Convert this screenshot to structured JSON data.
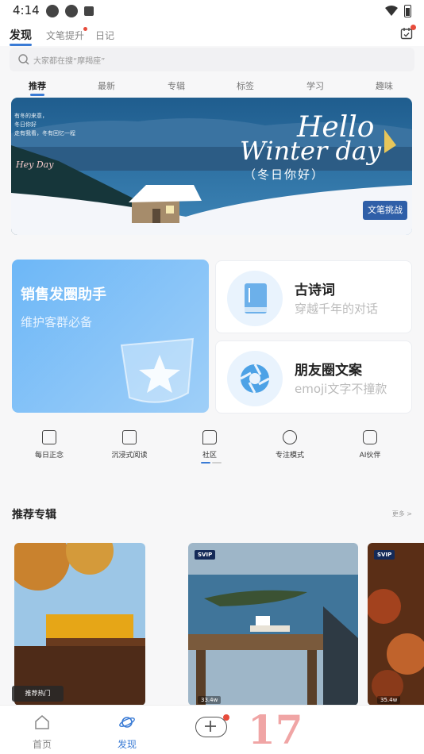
{
  "status": {
    "time": "4:14"
  },
  "header": {
    "tabs": [
      {
        "label": "发现",
        "active": true
      },
      {
        "label": "文笔提升",
        "active": false,
        "badge": true
      },
      {
        "label": "日记",
        "active": false
      }
    ]
  },
  "search": {
    "placeholder": "大家都在搜“摩羯座”"
  },
  "categories": [
    "推荐",
    "最新",
    "专辑",
    "标签",
    "学习",
    "趣味"
  ],
  "banner": {
    "title_line1": "Hello",
    "title_line2": "Winter day",
    "subtitle": "（冬日你好）",
    "button": "文笔挑战",
    "small_text": "有冬的来意，\n冬日你好\n走有我看，冬有回忆一程",
    "signature": "Hey Day"
  },
  "cards": {
    "big": {
      "title": "销售发圈助手",
      "subtitle": "维护客群必备"
    },
    "small": [
      {
        "title": "古诗词",
        "subtitle": "穿越千年的对话",
        "icon": "book-icon"
      },
      {
        "title": "朋友圈文案",
        "subtitle": "emoji文字不撞款",
        "icon": "aperture-icon"
      }
    ]
  },
  "quick_nav": [
    {
      "label": "每日正念",
      "icon": "note-icon"
    },
    {
      "label": "沉浸式阅读",
      "icon": "expand-icon"
    },
    {
      "label": "社区",
      "icon": "chat-icon"
    },
    {
      "label": "专注模式",
      "icon": "clock-icon"
    },
    {
      "label": "AI伙伴",
      "icon": "robot-icon"
    }
  ],
  "section": {
    "title": "推荐专辑",
    "more": "更多 >"
  },
  "albums": [
    {
      "badge": "推荐热门",
      "vip": false
    },
    {
      "badge": "SVIP",
      "views": "33.4w",
      "vip": true
    },
    {
      "badge": "SVIP",
      "views": "35.4w",
      "vip": true
    }
  ],
  "bottom_nav": [
    {
      "label": "首页",
      "active": false
    },
    {
      "label": "发现",
      "active": true
    }
  ],
  "overlay_logo": "17",
  "colors": {
    "accent": "#3a7bd5",
    "badge": "#e74c3c"
  }
}
